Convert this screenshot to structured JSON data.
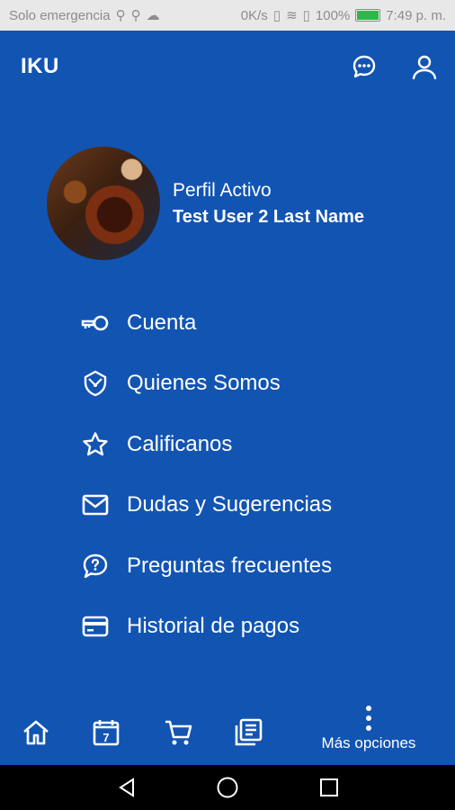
{
  "statusbar": {
    "carrier": "Solo emergencia",
    "speed": "0K/s",
    "battery": "100%",
    "time": "7:49 p. m."
  },
  "app": {
    "title": "IKU"
  },
  "profile": {
    "label": "Perfil Activo",
    "name": "Test User 2 Last Name"
  },
  "menu": [
    {
      "label": "Cuenta",
      "icon": "key-icon"
    },
    {
      "label": "Quienes Somos",
      "icon": "shield-info-icon"
    },
    {
      "label": "Calificanos",
      "icon": "star-icon"
    },
    {
      "label": "Dudas y Sugerencias",
      "icon": "mail-icon"
    },
    {
      "label": "Preguntas frecuentes",
      "icon": "help-bubble-icon"
    },
    {
      "label": "Historial de pagos",
      "icon": "credit-card-icon"
    }
  ],
  "bottom_nav": {
    "calendar_day": "7",
    "more_label": "Más opciones"
  },
  "colors": {
    "primary": "#1254b2",
    "statusbar_bg": "#e8e8e8",
    "navbar_bg": "#000000",
    "battery": "#2fb84a"
  }
}
